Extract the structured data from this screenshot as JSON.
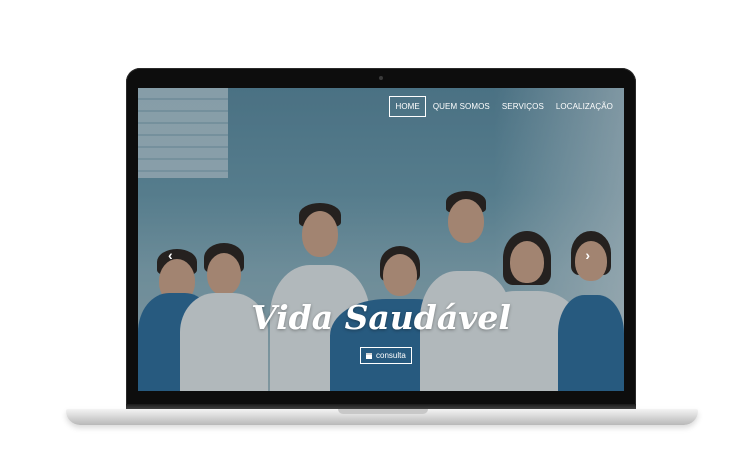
{
  "nav": {
    "items": [
      {
        "label": "HOME",
        "active": true
      },
      {
        "label": "QUEM SOMOS",
        "active": false
      },
      {
        "label": "SERVIÇOS",
        "active": false
      },
      {
        "label": "LOCALIZAÇÃO",
        "active": false
      }
    ]
  },
  "hero": {
    "title": "Vida Saudável",
    "cta_label": "consulta",
    "cta_icon": "calendar-icon",
    "prev_icon": "chevron-left-icon",
    "next_icon": "chevron-right-icon",
    "prev_glyph": "‹",
    "next_glyph": "›"
  },
  "colors": {
    "text": "#ffffff",
    "scrub_blue": "#2f6f9e",
    "coat_white": "#eef1f2"
  }
}
